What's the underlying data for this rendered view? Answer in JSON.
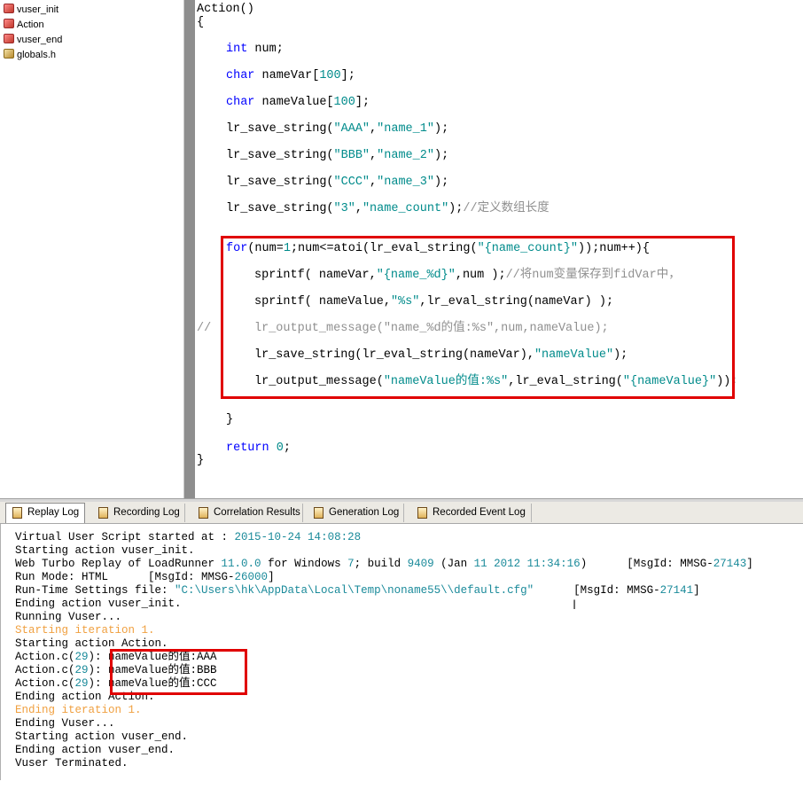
{
  "tree": {
    "items": [
      {
        "label": "vuser_init",
        "icon": "action-file-icon"
      },
      {
        "label": "Action",
        "icon": "action-file-icon"
      },
      {
        "label": "vuser_end",
        "icon": "action-file-icon"
      },
      {
        "label": "globals.h",
        "icon": "header-file-icon"
      }
    ]
  },
  "code": {
    "l01": "Action()",
    "l02": "{",
    "l03_kw": "int",
    "l03_rest": " num;",
    "l04_kw": "char",
    "l04_a": " nameVar[",
    "l04_n": "100",
    "l04_b": "];",
    "l05_kw": "char",
    "l05_a": " nameValue[",
    "l05_n": "100",
    "l05_b": "];",
    "l06_a": "lr_save_string(",
    "l06_s1": "\"AAA\"",
    "l06_c": ",",
    "l06_s2": "\"name_1\"",
    "l06_b": ");",
    "l07_a": "lr_save_string(",
    "l07_s1": "\"BBB\"",
    "l07_c": ",",
    "l07_s2": "\"name_2\"",
    "l07_b": ");",
    "l08_a": "lr_save_string(",
    "l08_s1": "\"CCC\"",
    "l08_c": ",",
    "l08_s2": "\"name_3\"",
    "l08_b": ");",
    "l09_a": "lr_save_string(",
    "l09_s1": "\"3\"",
    "l09_c": ",",
    "l09_s2": "\"name_count\"",
    "l09_b": ");",
    "l09_cm": "//定义数组长度",
    "l10_kw": "for",
    "l10_a": "(num=",
    "l10_n": "1",
    "l10_b": ";num<=atoi(lr_eval_string(",
    "l10_s": "\"{name_count}\"",
    "l10_c": "));num++){",
    "l11_a": "sprintf( nameVar,",
    "l11_s": "\"{name_%d}\"",
    "l11_b": ",num );",
    "l11_cm": "//将num变量保存到fidVar中，",
    "l12_a": "sprintf( nameValue,",
    "l12_s": "\"%s\"",
    "l12_b": ",lr_eval_string(nameVar) );",
    "l13_cm1": "//",
    "l13_cm2": "lr_output_message(\"name_%d的值:%s\",num,nameValue);",
    "l14_a": "lr_save_string(lr_eval_string(nameVar),",
    "l14_s": "\"nameValue\"",
    "l14_b": ");",
    "l15_a": "lr_output_message(",
    "l15_s1": "\"nameValue的值:%s\"",
    "l15_b": ",lr_eval_string(",
    "l15_s2": "\"{nameValue}\"",
    "l15_c": "));",
    "l16": "}",
    "l17_kw": "return",
    "l17_sp": " ",
    "l17_n": "0",
    "l17_b": ";",
    "l18": "}"
  },
  "tabs": [
    {
      "label": "Replay Log",
      "active": true
    },
    {
      "label": "Recording Log",
      "active": false
    },
    {
      "label": "Correlation Results",
      "active": false
    },
    {
      "label": "Generation Log",
      "active": false
    },
    {
      "label": "Recorded Event Log",
      "active": false
    }
  ],
  "log": {
    "r01_a": "Virtual User Script started at : ",
    "r01_t": "2015-10-24 14:08:28",
    "r02": "Starting action vuser_init.",
    "r03_a": "Web Turbo Replay of LoadRunner ",
    "r03_v": "11.0.0",
    "r03_b": " for Windows ",
    "r03_w": "7",
    "r03_c": "; build ",
    "r03_bn": "9409",
    "r03_d": " (Jan ",
    "r03_dd": "11 2012 11:34:16",
    "r03_e": ")      [MsgId: MMSG-",
    "r03_id": "27143",
    "r03_f": "]",
    "r04_a": "Run Mode: HTML      [MsgId: MMSG-",
    "r04_id": "26000",
    "r04_b": "]",
    "r05_a": "Run-Time Settings file: ",
    "r05_p": "\"C:\\Users\\hk\\AppData\\Local\\Temp\\noname55\\\\default.cfg\"",
    "r05_b": "      [MsgId: MMSG-",
    "r05_id": "27141",
    "r05_c": "]",
    "r06": "Ending action vuser_init.",
    "r07": "Running Vuser...",
    "r08": "Starting iteration 1.",
    "r09": "Starting action Action.",
    "r10_a": "Action.c(",
    "r10_n": "29",
    "r10_b": "): nameValue的值:AAA",
    "r11_a": "Action.c(",
    "r11_n": "29",
    "r11_b": "): nameValue的值:BBB",
    "r12_a": "Action.c(",
    "r12_n": "29",
    "r12_b": "): nameValue的值:CCC",
    "r13": "Ending action Action.",
    "r14": "Ending iteration 1.",
    "r15": "Ending Vuser...",
    "r16": "Starting action vuser_end.",
    "r17": "Ending action vuser_end.",
    "r18": "Vuser Terminated."
  },
  "colors": {
    "keyword": "#0000ff",
    "string": "#008b8b",
    "comment": "#909090",
    "iteration": "#f0a040",
    "highlight_box": "#e00000"
  }
}
